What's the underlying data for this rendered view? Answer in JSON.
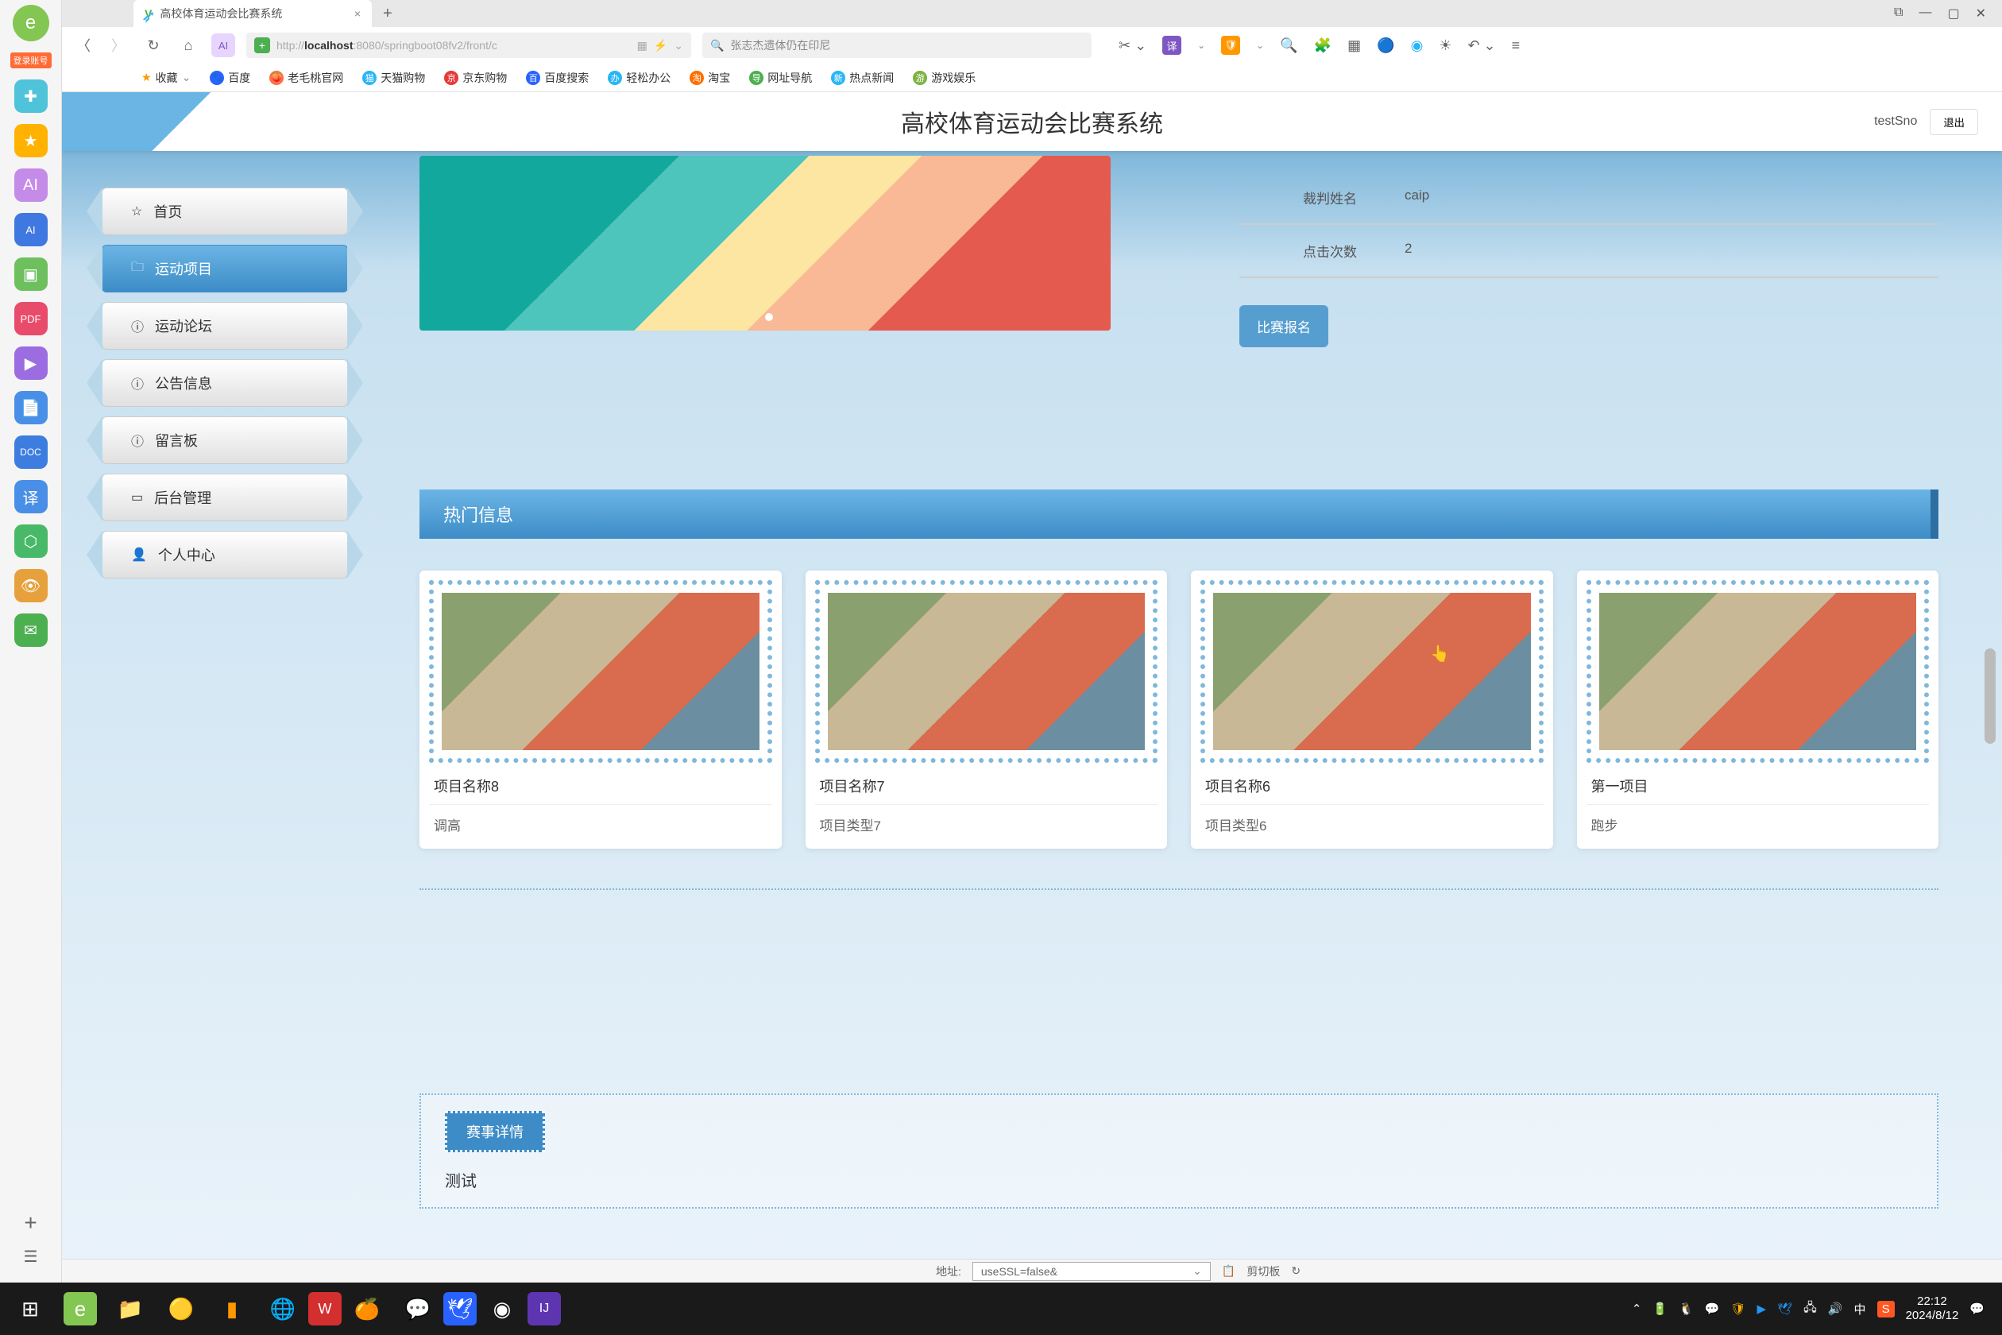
{
  "browser": {
    "tab_title": "高校体育运动会比赛系统",
    "url": "http://localhost:8080/springboot08fv2/front/c",
    "search_placeholder": "张志杰遗体仍在印尼",
    "login_badge": "登录账号"
  },
  "bookmarks": {
    "fav": "收藏",
    "items": [
      "百度",
      "老毛桃官网",
      "天猫购物",
      "京东购物",
      "百度搜索",
      "轻松办公",
      "淘宝",
      "网址导航",
      "热点新闻",
      "游戏娱乐"
    ]
  },
  "page_header": {
    "title": "高校体育运动会比赛系统",
    "user": "testSno",
    "logout": "退出"
  },
  "nav": {
    "items": [
      {
        "label": "首页",
        "icon": "☆"
      },
      {
        "label": "运动项目",
        "icon": "🗀",
        "active": true
      },
      {
        "label": "运动论坛",
        "icon": "ⓘ"
      },
      {
        "label": "公告信息",
        "icon": "ⓘ"
      },
      {
        "label": "留言板",
        "icon": "ⓘ"
      },
      {
        "label": "后台管理",
        "icon": "▭"
      },
      {
        "label": "个人中心",
        "icon": "👤"
      }
    ]
  },
  "info": {
    "rows": [
      {
        "label": "裁判姓名",
        "value": "caip"
      },
      {
        "label": "点击次数",
        "value": "2"
      }
    ],
    "signup": "比赛报名"
  },
  "hot": {
    "title": "热门信息",
    "cards": [
      {
        "title": "项目名称8",
        "sub": "调高"
      },
      {
        "title": "项目名称7",
        "sub": "项目类型7"
      },
      {
        "title": "项目名称6",
        "sub": "项目类型6"
      },
      {
        "title": "第一项目",
        "sub": "跑步"
      }
    ]
  },
  "detail": {
    "tab": "赛事详情",
    "text": "测试"
  },
  "status": {
    "label": "地址:",
    "value": "useSSL=false&",
    "clipboard": "剪切板",
    "recover": "↻"
  },
  "clock": {
    "time": "22:12",
    "date": "2024/8/12"
  },
  "ime": "中"
}
